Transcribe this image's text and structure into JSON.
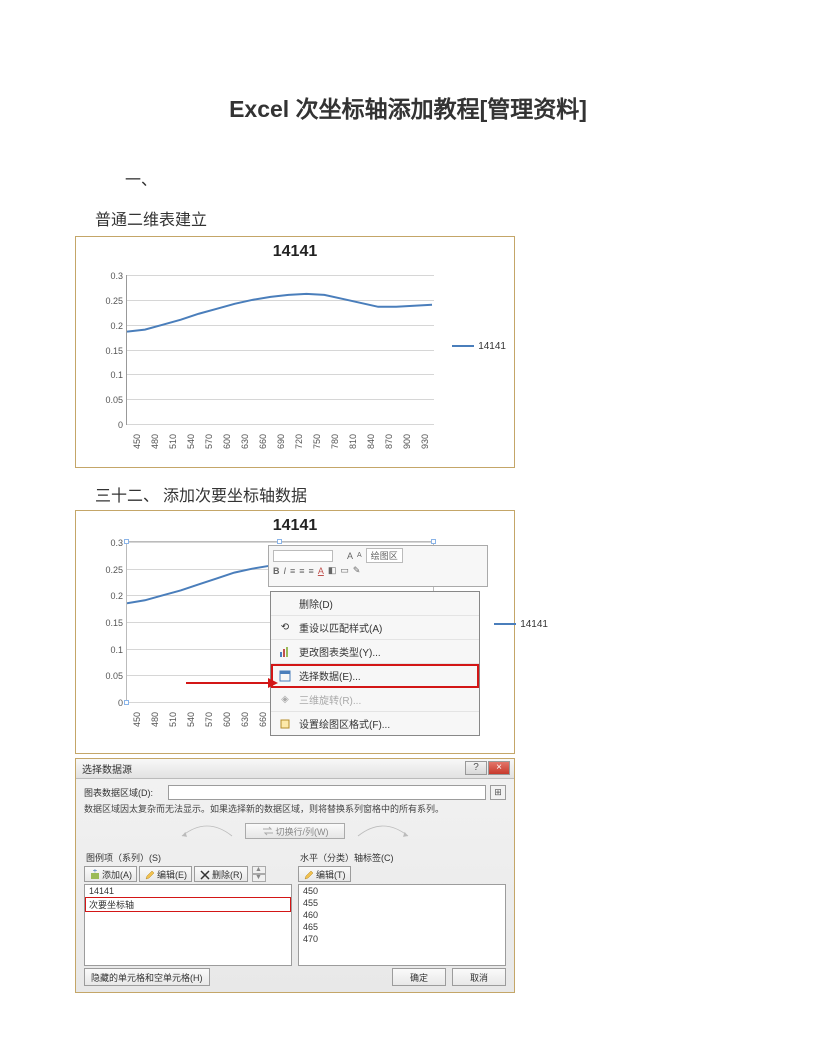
{
  "doc": {
    "title": "Excel 次坐标轴添加教程[管理资料]",
    "section1_num": "一、",
    "section1_sub": "普通二维表建立",
    "section2_num": "三十二、 添加次要坐标轴数据"
  },
  "chart_data": [
    {
      "type": "line",
      "title": "14141",
      "series": [
        {
          "name": "14141",
          "values": [
            0.185,
            0.19,
            0.2,
            0.21,
            0.221,
            0.232,
            0.242,
            0.25,
            0.256,
            0.26,
            0.262,
            0.26,
            0.252,
            0.245,
            0.237,
            0.236,
            0.238,
            0.24
          ]
        }
      ],
      "x": [
        450,
        480,
        510,
        540,
        570,
        600,
        630,
        660,
        690,
        720,
        750,
        780,
        810,
        840,
        870,
        900,
        930,
        960
      ],
      "xticks": [
        450,
        480,
        510,
        540,
        570,
        600,
        630,
        660,
        690,
        720,
        750,
        780,
        810,
        840,
        870,
        900,
        930
      ],
      "yticks": [
        0,
        0.05,
        0.1,
        0.15,
        0.2,
        0.25,
        0.3
      ],
      "ylim": [
        0,
        0.3
      ],
      "xlabel": "",
      "ylabel": ""
    },
    {
      "type": "line",
      "title": "14141",
      "series": [
        {
          "name": "14141",
          "values": [
            0.185,
            0.19,
            0.2,
            0.21,
            0.221,
            0.232,
            0.242,
            0.25,
            0.256,
            0.26,
            0.262,
            0.26,
            0.252,
            0.245,
            0.237,
            0.236,
            0.238,
            0.24
          ]
        }
      ],
      "x": [
        450,
        480,
        510,
        540,
        570,
        600,
        630,
        660,
        690,
        720,
        750,
        780,
        810,
        840,
        870,
        900,
        930,
        960
      ],
      "xticks": [
        450,
        480,
        510,
        540,
        570,
        600,
        630,
        660
      ],
      "yticks": [
        0,
        0.05,
        0.1,
        0.15,
        0.2,
        0.25,
        0.3
      ],
      "ylim": [
        0,
        0.3
      ],
      "xlabel": "",
      "ylabel": ""
    }
  ],
  "mini_toolbar": {
    "area_label": "绘图区",
    "font_big": "A",
    "font_small": "A"
  },
  "context_menu": {
    "items": [
      {
        "label": "删除(D)"
      },
      {
        "label": "重设以匹配样式(A)"
      },
      {
        "label": "更改图表类型(Y)..."
      },
      {
        "label": "选择数据(E)...",
        "highlight": true
      },
      {
        "label": "三维旋转(R)...",
        "disabled": true
      },
      {
        "label": "设置绘图区格式(F)..."
      }
    ]
  },
  "legend2": "14141",
  "dialog": {
    "title": "选择数据源",
    "help_icon": "?",
    "close_icon": "×",
    "range_label": "图表数据区域(D):",
    "hint": "数据区域因太复杂而无法显示。如果选择新的数据区域，则将替换系列窗格中的所有系列。",
    "switch_label": "切换行/列(W)",
    "left_col": {
      "title": "图例项（系列）(S)",
      "add": "添加(A)",
      "edit": "编辑(E)",
      "delete": "删除(R)",
      "items": [
        "14141",
        "次要坐标轴"
      ]
    },
    "right_col": {
      "title": "水平（分类）轴标签(C)",
      "edit": "编辑(T)",
      "items": [
        "450",
        "455",
        "460",
        "465",
        "470"
      ]
    },
    "footer": {
      "hidden_cells": "隐藏的单元格和空单元格(H)",
      "ok": "确定",
      "cancel": "取消"
    }
  }
}
